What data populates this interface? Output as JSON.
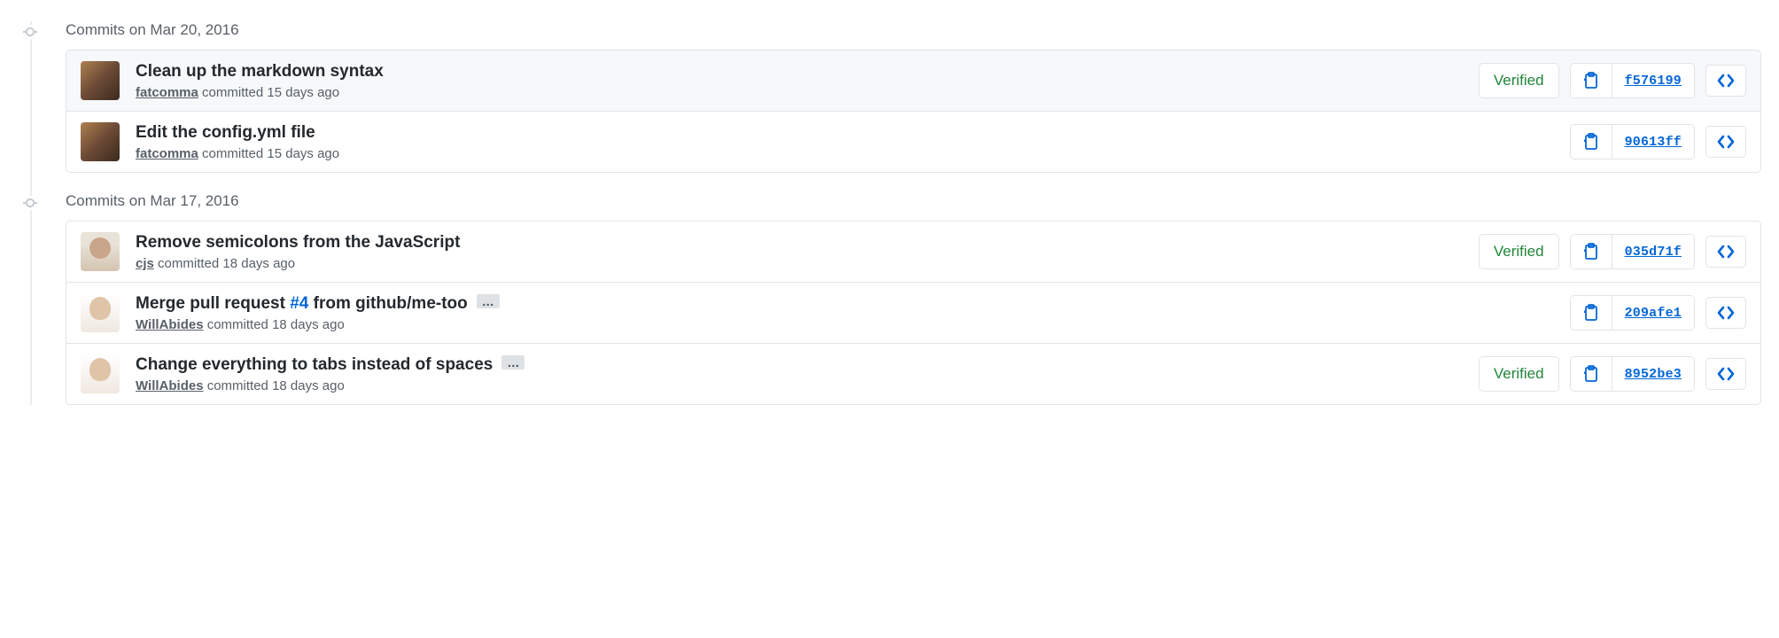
{
  "groups": [
    {
      "heading": "Commits on Mar 20, 2016",
      "commits": [
        {
          "title_pre": "Clean up the markdown syntax",
          "pr": "",
          "title_post": "",
          "author": "fatcomma",
          "meta_suffix": "committed 15 days ago",
          "verified": "Verified",
          "sha": "f576199",
          "highlighted": true,
          "show_verified": true,
          "show_ellipsis": false,
          "avatar_class": "fatcomma"
        },
        {
          "title_pre": "Edit the config.yml file",
          "pr": "",
          "title_post": "",
          "author": "fatcomma",
          "meta_suffix": "committed 15 days ago",
          "verified": "",
          "sha": "90613ff",
          "highlighted": false,
          "show_verified": false,
          "show_ellipsis": false,
          "avatar_class": "fatcomma"
        }
      ]
    },
    {
      "heading": "Commits on Mar 17, 2016",
      "commits": [
        {
          "title_pre": "Remove semicolons from the JavaScript",
          "pr": "",
          "title_post": "",
          "author": "cjs",
          "meta_suffix": "committed 18 days ago",
          "verified": "Verified",
          "sha": "035d71f",
          "highlighted": false,
          "show_verified": true,
          "show_ellipsis": false,
          "avatar_class": "cjs"
        },
        {
          "title_pre": "Merge pull request ",
          "pr": "#4",
          "title_post": " from github/me-too",
          "author": "WillAbides",
          "meta_suffix": "committed 18 days ago",
          "verified": "",
          "sha": "209afe1",
          "highlighted": false,
          "show_verified": false,
          "show_ellipsis": true,
          "avatar_class": "willabides"
        },
        {
          "title_pre": "Change everything to tabs instead of spaces",
          "pr": "",
          "title_post": "",
          "author": "WillAbides",
          "meta_suffix": "committed 18 days ago",
          "verified": "Verified",
          "sha": "8952be3",
          "highlighted": false,
          "show_verified": true,
          "show_ellipsis": true,
          "avatar_class": "willabides"
        }
      ]
    }
  ],
  "icons": {
    "clipboard": "clipboard-icon",
    "code": "code-icon",
    "commit_node": "git-commit-icon"
  }
}
